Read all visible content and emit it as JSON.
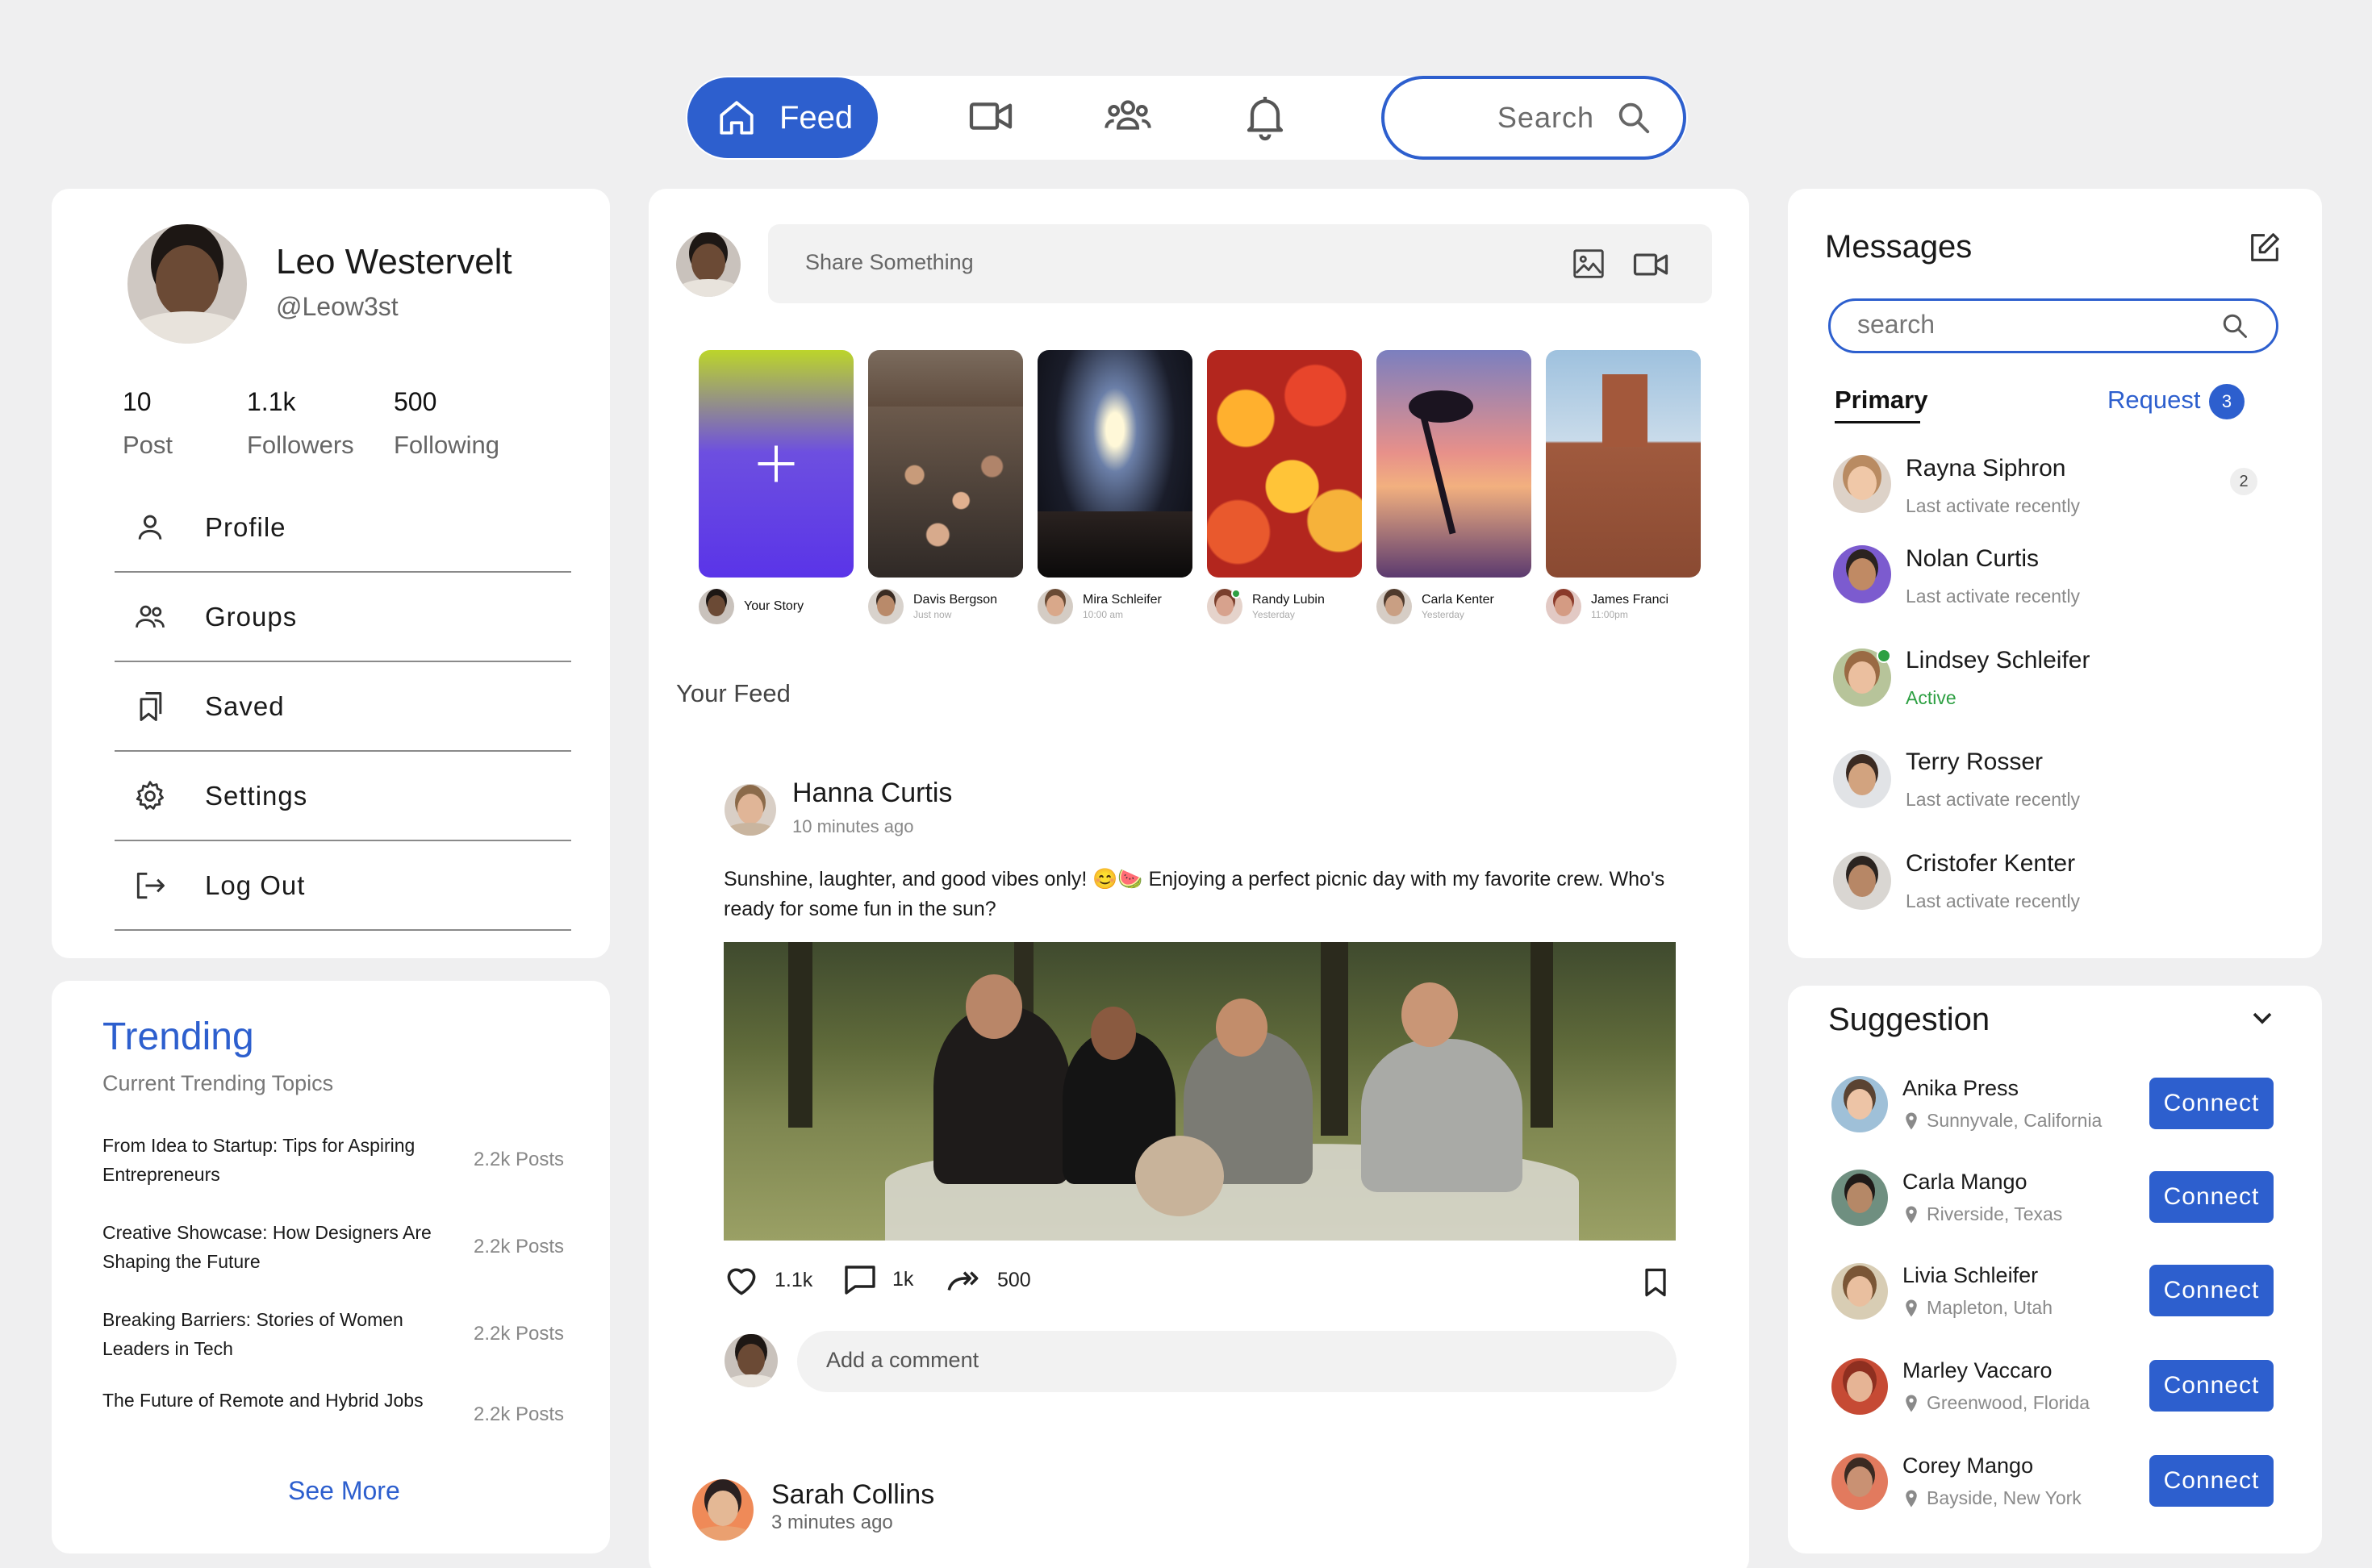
{
  "nav": {
    "feed_label": "Feed",
    "search_label": "Search",
    "icons": [
      "home-icon",
      "video-icon",
      "groups-icon",
      "bell-icon",
      "search-icon"
    ],
    "accent_color": "#2d5fce"
  },
  "profile": {
    "name": "Leo Westervelt",
    "handle": "@Leow3st",
    "stats": [
      {
        "value": "10",
        "label": "Post"
      },
      {
        "value": "1.1k",
        "label": "Followers"
      },
      {
        "value": "500",
        "label": "Following"
      }
    ],
    "menu": [
      {
        "label": "Profile",
        "icon": "user-icon"
      },
      {
        "label": "Groups",
        "icon": "groups-icon"
      },
      {
        "label": "Saved",
        "icon": "bookmarks-icon"
      },
      {
        "label": "Settings",
        "icon": "gear-icon"
      },
      {
        "label": "Log Out",
        "icon": "logout-icon"
      }
    ]
  },
  "trending": {
    "title": "Trending",
    "subtitle": "Current Trending Topics",
    "items": [
      {
        "title": "From Idea to Startup: Tips for Aspiring Entrepreneurs",
        "count": "2.2k Posts"
      },
      {
        "title": "Creative Showcase: How Designers Are Shaping the Future",
        "count": "2.2k Posts"
      },
      {
        "title": "Breaking Barriers: Stories of Women Leaders in Tech",
        "count": "2.2k Posts"
      },
      {
        "title": "The Future of Remote and Hybrid Jobs",
        "count": "2.2k Posts"
      }
    ],
    "see_more": "See More"
  },
  "composer": {
    "placeholder": "Share Something"
  },
  "stories": [
    {
      "name": "Your Story",
      "time": ""
    },
    {
      "name": "Davis Bergson",
      "time": "Just now"
    },
    {
      "name": "Mira Schleifer",
      "time": "10:00 am"
    },
    {
      "name": "Randy Lubin",
      "time": "Yesterday"
    },
    {
      "name": "Carla Kenter",
      "time": "Yesterday"
    },
    {
      "name": "James Franci",
      "time": "11:00pm"
    }
  ],
  "feed": {
    "title": "Your Feed",
    "post": {
      "author": "Hanna Curtis",
      "time": "10 minutes ago",
      "text": "Sunshine, laughter, and good vibes only! 😊🍉 Enjoying a perfect picnic day with my favorite crew. Who's ready for some fun in the sun?",
      "likes": "1.1k",
      "comments": "1k",
      "shares": "500",
      "comment_placeholder": "Add a comment"
    },
    "next_post": {
      "author": "Sarah Collins",
      "time": "3 minutes ago"
    }
  },
  "messages": {
    "title": "Messages",
    "search_placeholder": "search",
    "tab_primary": "Primary",
    "tab_request": "Request",
    "request_count": "3",
    "items": [
      {
        "name": "Rayna Siphron",
        "status": "Last activate recently",
        "unread": "2"
      },
      {
        "name": "Nolan Curtis",
        "status": "Last activate recently"
      },
      {
        "name": "Lindsey Schleifer",
        "status": "Active"
      },
      {
        "name": "Terry Rosser",
        "status": "Last activate recently"
      },
      {
        "name": "Cristofer Kenter",
        "status": "Last activate recently"
      }
    ],
    "active_color": "#2ea043"
  },
  "suggestion": {
    "title": "Suggestion",
    "connect_label": "Connect",
    "items": [
      {
        "name": "Anika Press",
        "location": "Sunnyvale, California"
      },
      {
        "name": "Carla Mango",
        "location": "Riverside, Texas"
      },
      {
        "name": "Livia Schleifer",
        "location": "Mapleton, Utah"
      },
      {
        "name": "Marley Vaccaro",
        "location": "Greenwood, Florida"
      },
      {
        "name": "Corey Mango",
        "location": "Bayside, New York"
      }
    ]
  }
}
